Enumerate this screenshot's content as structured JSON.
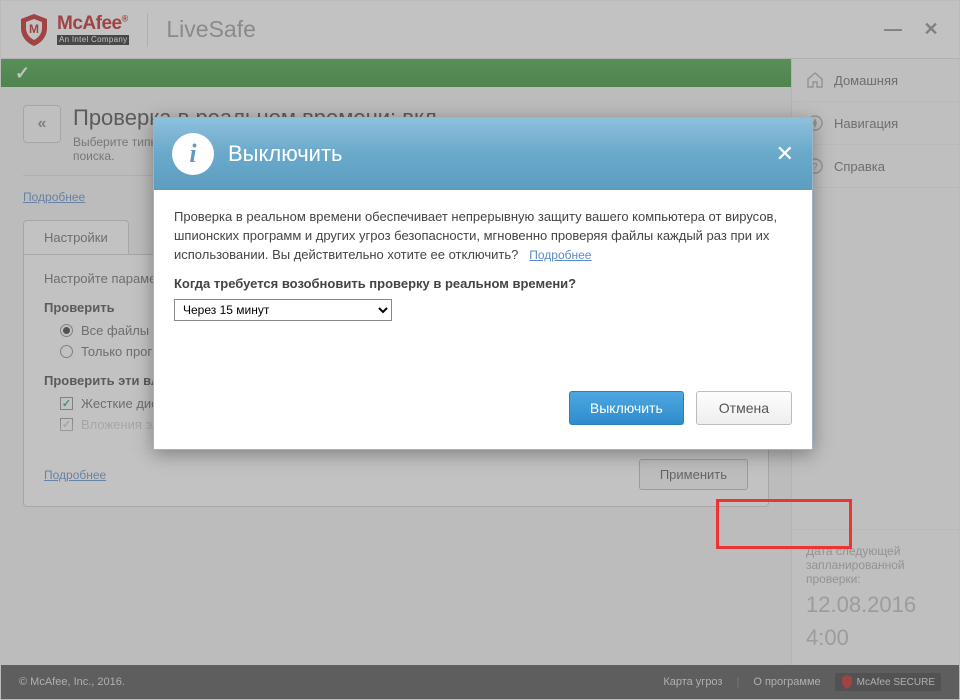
{
  "brand": {
    "name": "McAfee",
    "sub": "An Intel Company",
    "product": "LiveSafe"
  },
  "nav": {
    "items": [
      {
        "label": "Домашняя"
      },
      {
        "label": "Навигация"
      },
      {
        "label": "Справка"
      }
    ]
  },
  "page": {
    "title": "Проверка в реальном времени: вкл",
    "subtitle": "Выберите типы файлов, которые McAfee будет проверять в реальном времени, а также угрозы для поиска.",
    "details_link": "Подробнее",
    "tab": "Настройки",
    "settings_caption": "Настройте параметры проверки в реальном времени.",
    "group1_label": "Проверить",
    "radio1": "Все файлы (рекомендуется)",
    "radio2": "Только программы и документы",
    "group2_label": "Проверить эти вложения и расположения",
    "check1": "Жесткие диски ПК (автоматически)",
    "check2": "Вложения электронной почты",
    "apply": "Применить"
  },
  "schedule": {
    "caption": "Дата следующей запланированной проверки:",
    "date": "12.08.2016",
    "time": "4:00"
  },
  "footer": {
    "copyright": "© McAfee, Inc., 2016.",
    "link1": "Карта угроз",
    "link2": "О программе",
    "badge": "McAfee SECURE"
  },
  "modal": {
    "title": "Выключить",
    "body": "Проверка в реальном времени обеспечивает непрерывную защиту вашего компьютера от вирусов, шпионских программ и других угроз безопасности, мгновенно проверяя файлы каждый раз при их использовании. Вы действительно хотите ее отключить?",
    "more": "Подробнее",
    "question": "Когда требуется возобновить проверку в реальном времени?",
    "selected": "Через 15 минут",
    "confirm": "Выключить",
    "cancel": "Отмена"
  }
}
